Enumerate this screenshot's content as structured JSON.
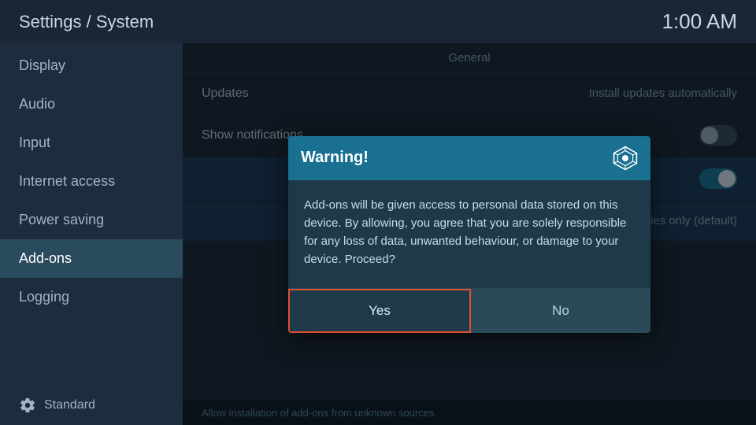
{
  "header": {
    "title": "Settings / System",
    "time": "1:00 AM"
  },
  "sidebar": {
    "items": [
      {
        "id": "display",
        "label": "Display",
        "active": false
      },
      {
        "id": "audio",
        "label": "Audio",
        "active": false
      },
      {
        "id": "input",
        "label": "Input",
        "active": false
      },
      {
        "id": "internet-access",
        "label": "Internet access",
        "active": false
      },
      {
        "id": "power-saving",
        "label": "Power saving",
        "active": false
      },
      {
        "id": "add-ons",
        "label": "Add-ons",
        "active": true
      },
      {
        "id": "logging",
        "label": "Logging",
        "active": false
      }
    ],
    "footer_label": "Standard"
  },
  "content": {
    "section_label": "General",
    "settings": [
      {
        "id": "updates",
        "label": "Updates",
        "value": "Install updates automatically",
        "type": "value"
      },
      {
        "id": "show-notifications",
        "label": "Show notifications",
        "value": "",
        "type": "toggle",
        "toggle_state": "off"
      },
      {
        "id": "unknown-row",
        "label": "",
        "value": "",
        "type": "toggle",
        "toggle_state": "on",
        "highlighted": true
      },
      {
        "id": "repositories",
        "label": "",
        "value": "Official repositories only (default)",
        "type": "value",
        "highlighted": true
      }
    ],
    "status_text": "Allow installation of add-ons from unknown sources."
  },
  "dialog": {
    "title": "Warning!",
    "body": "Add-ons will be given access to personal data stored on this device. By allowing, you agree that you are solely responsible for any loss of data, unwanted behaviour, or damage to your device. Proceed?",
    "yes_label": "Yes",
    "no_label": "No"
  }
}
